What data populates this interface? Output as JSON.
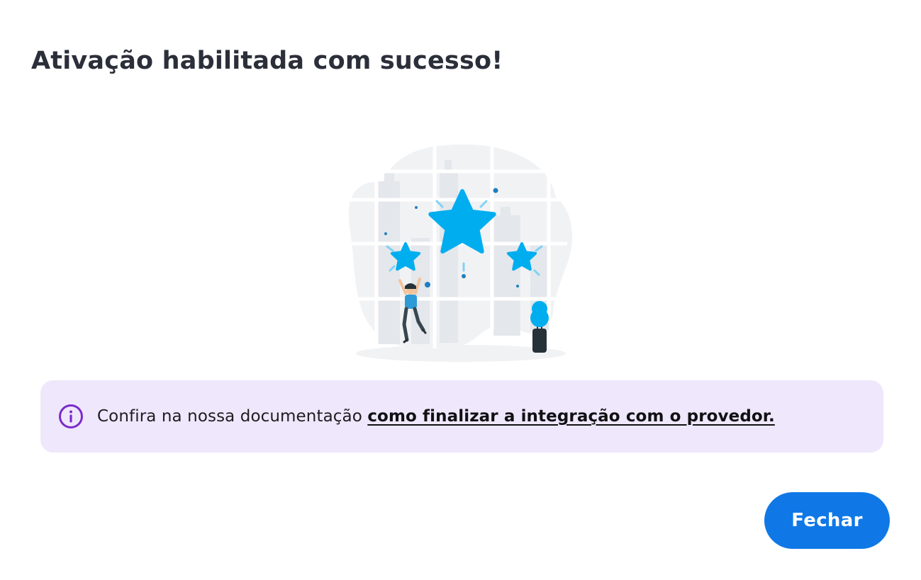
{
  "dialog": {
    "title": "Ativação habilitada com sucesso!",
    "illustration_icon": "stars-celebration-illustration"
  },
  "info": {
    "icon": "info-icon",
    "text": "Confira na nossa documentação ",
    "link_label": "como finalizar a integração com o provedor."
  },
  "actions": {
    "close_label": "Fechar"
  },
  "colors": {
    "primary_button": "#0f78e6",
    "info_background": "#efe7fb",
    "info_icon": "#7a2cc9",
    "star": "#00aeef",
    "title": "#2b2f3a"
  }
}
